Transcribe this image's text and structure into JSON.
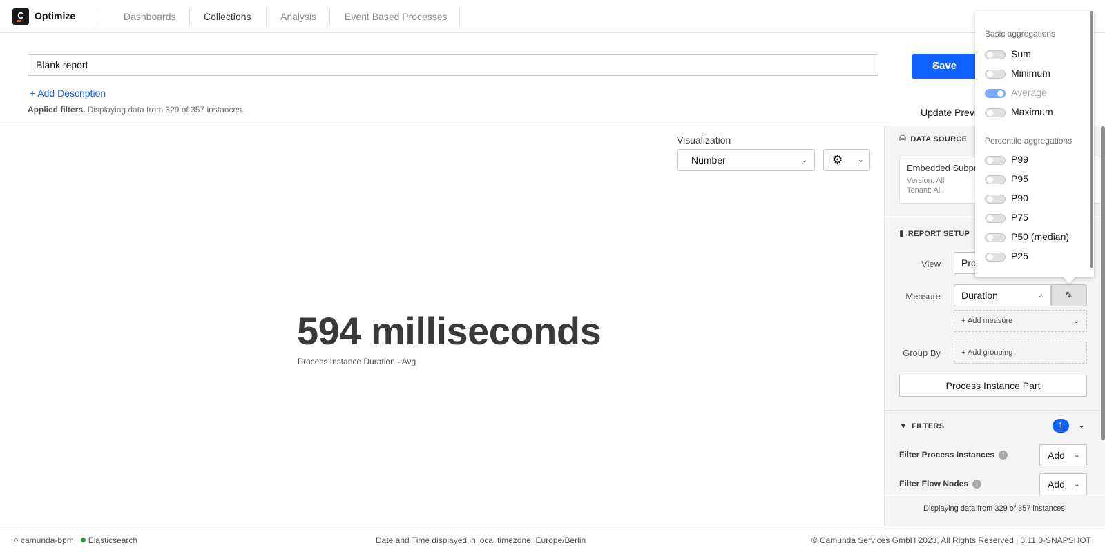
{
  "nav": {
    "logo_letter": "C",
    "brand": "Optimize",
    "items": [
      {
        "label": "Dashboards"
      },
      {
        "label": "Collections"
      },
      {
        "label": "Analysis"
      },
      {
        "label": "Event Based Processes"
      }
    ]
  },
  "header": {
    "report_name": "Blank report",
    "add_description": "+ Add Description",
    "applied_filters_bold": "Applied filters.",
    "applied_filters_text": "Displaying data from 329 of 357 instances.",
    "save_label": "Save",
    "update_preview": "Update Previ"
  },
  "main": {
    "visualization_label": "Visualization",
    "visualization_value": "Number",
    "number_value": "594 milliseconds",
    "number_caption": "Process Instance Duration - Avg"
  },
  "sidebar": {
    "data_source_title": "DATA SOURCE",
    "ds_name": "Embedded Subpr",
    "ds_version": "Version: All",
    "ds_tenant": "Tenant: All",
    "report_setup_title": "REPORT SETUP",
    "view_label": "View",
    "view_value": "Pro",
    "measure_label": "Measure",
    "measure_value": "Duration",
    "add_measure": "+ Add measure",
    "group_by_label": "Group By",
    "add_grouping": "+ Add grouping",
    "process_instance_part": "Process Instance Part",
    "filters_title": "FILTERS",
    "filters_count": "1",
    "filter_process_instances": "Filter Process Instances",
    "filter_flow_nodes": "Filter Flow Nodes",
    "add_label": "Add",
    "footer_text": "Displaying data from 329 of 357 instances."
  },
  "popover": {
    "basic_heading": "Basic aggregations",
    "basic": [
      {
        "label": "Sum",
        "on": false
      },
      {
        "label": "Minimum",
        "on": false
      },
      {
        "label": "Average",
        "on": true
      },
      {
        "label": "Maximum",
        "on": false
      }
    ],
    "percentile_heading": "Percentile aggregations",
    "percentile": [
      {
        "label": "P99",
        "on": false
      },
      {
        "label": "P95",
        "on": false
      },
      {
        "label": "P90",
        "on": false
      },
      {
        "label": "P75",
        "on": false
      },
      {
        "label": "P50 (median)",
        "on": false
      },
      {
        "label": "P25",
        "on": false
      }
    ]
  },
  "footer": {
    "engine": "camunda-bpm",
    "database": "Elasticsearch",
    "timezone": "Date and Time displayed in local timezone: Europe/Berlin",
    "copyright": "© Camunda Services GmbH 2023, All Rights Reserved | 3.11.0-SNAPSHOT"
  },
  "colors": {
    "primary": "#0f62fe",
    "toggle_on": "#78a9ff",
    "logo_accent": "#fc5d0d",
    "status_ok": "#24a148"
  }
}
